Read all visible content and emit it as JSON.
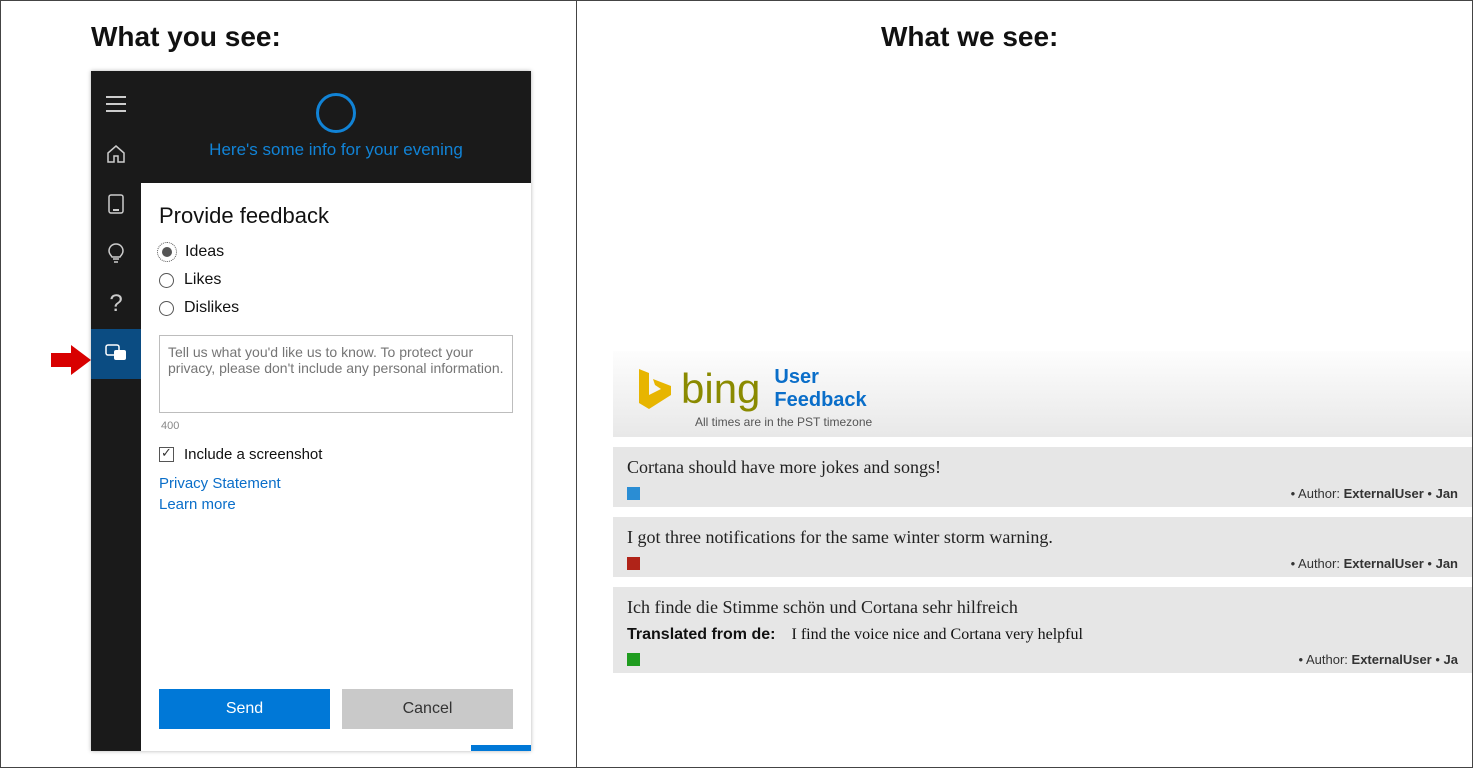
{
  "heading_left": "What you see:",
  "heading_right": "What we see:",
  "cortana": {
    "header_text": "Here's some info for your evening",
    "feedback_title": "Provide feedback",
    "options": {
      "ideas": "Ideas",
      "likes": "Likes",
      "dislikes": "Dislikes"
    },
    "textarea_placeholder": "Tell us what you'd like us to know. To protect your privacy, please don't include any personal information.",
    "char_count": "400",
    "screenshot_label": "Include a screenshot",
    "privacy_link": "Privacy Statement",
    "learn_more_link": "Learn more",
    "send_label": "Send",
    "cancel_label": "Cancel",
    "nav": [
      "menu",
      "home",
      "notebook",
      "bulb",
      "help",
      "feedback"
    ]
  },
  "bing_report": {
    "word": "bing",
    "subtitle_line1": "User",
    "subtitle_line2": "Feedback",
    "timezone_note": "All times are in the PST timezone",
    "items": [
      {
        "text": "Cortana should have more jokes and songs!",
        "color": "blue",
        "author_label": "Author:",
        "author": "ExternalUser",
        "date": "Jan"
      },
      {
        "text": "I got three notifications for the same winter storm warning.",
        "color": "red",
        "author_label": "Author:",
        "author": "ExternalUser",
        "date": "Jan"
      },
      {
        "text": "Ich finde die Stimme schön und Cortana sehr hilfreich",
        "translated_label": "Translated from de:",
        "translated_text": "I find the voice nice and Cortana very helpful",
        "color": "green",
        "author_label": "Author:",
        "author": "ExternalUser",
        "date": "Ja"
      }
    ]
  },
  "colors": {
    "accent": "#0078d7",
    "cortana_blue": "#1183d6",
    "link": "#0a6ec9"
  }
}
